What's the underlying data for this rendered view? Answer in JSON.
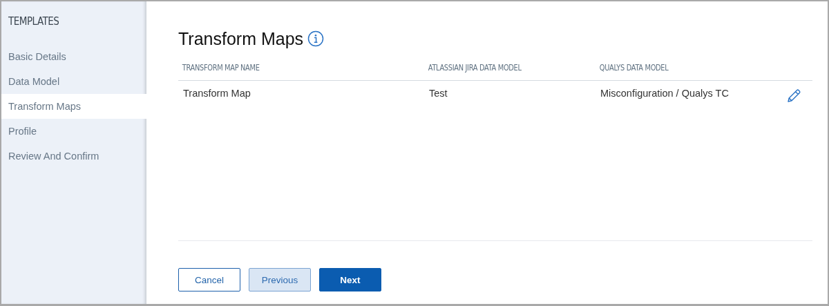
{
  "sidebar": {
    "title": "TEMPLATES",
    "items": [
      {
        "label": "Basic Details",
        "selected": false
      },
      {
        "label": "Data Model",
        "selected": false
      },
      {
        "label": "Transform Maps",
        "selected": true
      },
      {
        "label": "Profile",
        "selected": false
      },
      {
        "label": "Review And Confirm",
        "selected": false
      }
    ]
  },
  "page": {
    "title": "Transform Maps"
  },
  "table": {
    "columns": [
      "TRANSFORM MAP NAME",
      "ATLASSIAN JIRA DATA MODEL",
      "QUALYS DATA MODEL"
    ],
    "rows": [
      {
        "cells": [
          "Transform Map",
          "Test",
          "Misconfiguration / Qualys TC"
        ]
      }
    ]
  },
  "buttons": [
    {
      "label": "Cancel",
      "kind": "outline"
    },
    {
      "label": "Previous",
      "kind": "secondary"
    },
    {
      "label": "Next",
      "kind": "primary"
    }
  ]
}
